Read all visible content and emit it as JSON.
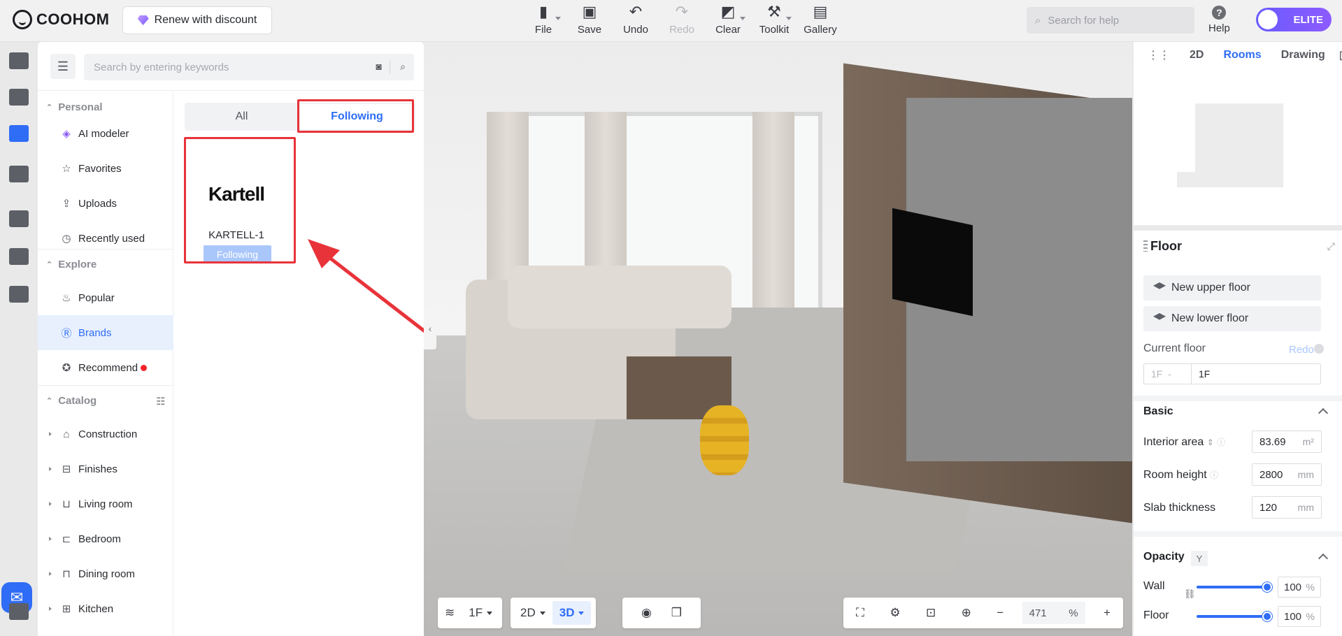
{
  "app": {
    "brand": "COOHOM",
    "renew_label": "Renew with discount"
  },
  "toolbar": [
    {
      "label": "File",
      "icon": "file-icon",
      "glyph": "▮",
      "caret": true,
      "disabled": false
    },
    {
      "label": "Save",
      "icon": "save-icon",
      "glyph": "▣",
      "caret": false,
      "disabled": false
    },
    {
      "label": "Undo",
      "icon": "undo-icon",
      "glyph": "↶",
      "caret": false,
      "disabled": false
    },
    {
      "label": "Redo",
      "icon": "redo-icon",
      "glyph": "↷",
      "caret": false,
      "disabled": true
    },
    {
      "label": "Clear",
      "icon": "eraser-icon",
      "glyph": "◩",
      "caret": true,
      "disabled": false
    },
    {
      "label": "Toolkit",
      "icon": "wrench-icon",
      "glyph": "⚒",
      "caret": true,
      "disabled": false
    },
    {
      "label": "Gallery",
      "icon": "gallery-icon",
      "glyph": "▤",
      "caret": false,
      "disabled": false
    }
  ],
  "help_search": {
    "placeholder": "Search for help"
  },
  "help_label": "Help",
  "elite_label": "ELITE",
  "panel": {
    "search_placeholder": "Search by entering keywords",
    "sections": {
      "personal": "Personal",
      "explore": "Explore",
      "catalog": "Catalog"
    },
    "personal_items": [
      "AI modeler",
      "Favorites",
      "Uploads",
      "Recently used"
    ],
    "explore_items": [
      "Popular",
      "Brands",
      "Recommend"
    ],
    "catalog_items": [
      "Construction",
      "Finishes",
      "Living room",
      "Bedroom",
      "Dining room",
      "Kitchen"
    ],
    "tabs": {
      "all": "All",
      "following": "Following"
    },
    "brand": {
      "logo_text": "Kartell",
      "name": "KARTELL-1",
      "status": "Following"
    }
  },
  "viewport": {
    "floor_label": "1F",
    "mode_2d": "2D",
    "mode_3d": "3D",
    "zoom_value": "471",
    "zoom_unit": "%"
  },
  "minimap": {
    "tabs": [
      "2D",
      "Rooms",
      "Drawing"
    ],
    "active_tab": "Rooms"
  },
  "floor_panel": {
    "title": "Floor",
    "new_upper": "New upper floor",
    "new_lower": "New lower floor",
    "current_floor_label": "Current floor",
    "redo_label": "Redo",
    "current_from": "1F",
    "current_to": "1F",
    "basic_label": "Basic",
    "interior_area_label": "Interior area",
    "interior_area_value": "83.69",
    "interior_area_unit": "m²",
    "room_height_label": "Room height",
    "room_height_value": "2800",
    "room_height_unit": "mm",
    "slab_label": "Slab thickness",
    "slab_value": "120",
    "slab_unit": "mm",
    "opacity_label": "Opacity",
    "opacity_tag": "Y",
    "wall_label": "Wall",
    "wall_value": "100",
    "floor_label": "Floor",
    "floor_value": "100",
    "percent": "%"
  },
  "colors": {
    "accent": "#2f6df6",
    "highlight_box": "#e8333a",
    "elite": "#7b5cff"
  }
}
